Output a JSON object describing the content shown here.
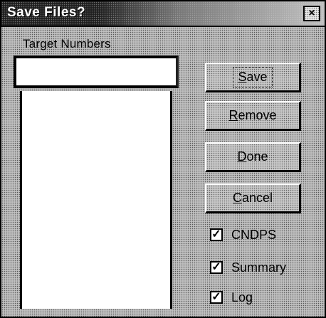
{
  "window": {
    "title": "Save Files?",
    "close_glyph": "×"
  },
  "group": {
    "label": "Target Numbers"
  },
  "target_input": {
    "value": "",
    "placeholder": ""
  },
  "buttons": {
    "save": "Save",
    "remove": "Remove",
    "done": "Done",
    "cancel": "Cancel"
  },
  "options": [
    {
      "label": "CNDPS",
      "checked": true,
      "check_glyph": "✓"
    },
    {
      "label": "Summary",
      "checked": true,
      "check_glyph": "✓"
    },
    {
      "label": "Log",
      "checked": true,
      "check_glyph": "✓"
    }
  ]
}
